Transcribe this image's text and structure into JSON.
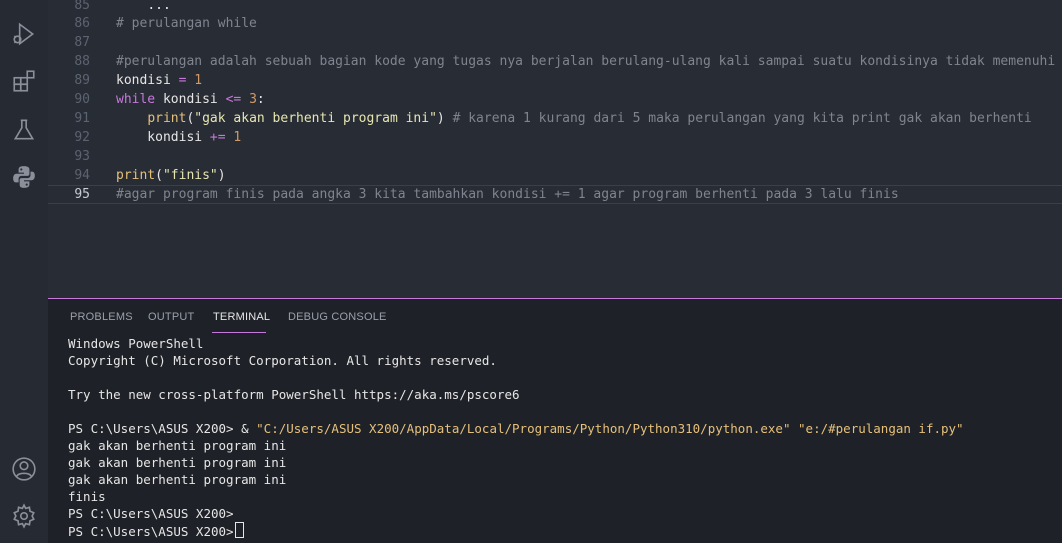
{
  "activity_bar": {
    "icons": [
      "run-debug-icon",
      "extensions-icon",
      "testing-icon",
      "python-icon",
      "account-icon",
      "settings-gear-icon"
    ]
  },
  "editor": {
    "lines": [
      {
        "num": "85",
        "tokens": [
          {
            "t": "    ",
            "c": ""
          },
          {
            "t": "...",
            "c": "c-var"
          }
        ]
      },
      {
        "num": "86",
        "tokens": [
          {
            "t": "# perulangan while",
            "c": "c-comment"
          }
        ]
      },
      {
        "num": "87",
        "tokens": []
      },
      {
        "num": "88",
        "tokens": [
          {
            "t": "#perulangan adalah sebuah bagian kode yang tugas nya berjalan berulang-ulang kali sampai suatu kondisinya tidak memenuhi",
            "c": "c-comment"
          }
        ]
      },
      {
        "num": "89",
        "tokens": [
          {
            "t": "kondisi ",
            "c": "c-var"
          },
          {
            "t": "=",
            "c": "c-op"
          },
          {
            "t": " ",
            "c": ""
          },
          {
            "t": "1",
            "c": "c-num"
          }
        ]
      },
      {
        "num": "90",
        "tokens": [
          {
            "t": "while",
            "c": "c-kw"
          },
          {
            "t": " kondisi ",
            "c": "c-var"
          },
          {
            "t": "<=",
            "c": "c-op"
          },
          {
            "t": " ",
            "c": ""
          },
          {
            "t": "3",
            "c": "c-num"
          },
          {
            "t": ":",
            "c": "c-var"
          }
        ]
      },
      {
        "num": "91",
        "tokens": [
          {
            "t": "    ",
            "c": ""
          },
          {
            "t": "print",
            "c": "c-fn"
          },
          {
            "t": "(",
            "c": "c-var"
          },
          {
            "t": "\"gak akan berhenti program ini\"",
            "c": "c-str"
          },
          {
            "t": ") ",
            "c": "c-var"
          },
          {
            "t": "# karena 1 kurang dari 5 maka perulangan yang kita print gak akan berhenti",
            "c": "c-comment"
          }
        ]
      },
      {
        "num": "92",
        "tokens": [
          {
            "t": "    kondisi ",
            "c": "c-var"
          },
          {
            "t": "+=",
            "c": "c-op"
          },
          {
            "t": " ",
            "c": ""
          },
          {
            "t": "1",
            "c": "c-num"
          }
        ]
      },
      {
        "num": "93",
        "tokens": []
      },
      {
        "num": "94",
        "tokens": [
          {
            "t": "print",
            "c": "c-fn"
          },
          {
            "t": "(",
            "c": "c-var"
          },
          {
            "t": "\"finis\"",
            "c": "c-str"
          },
          {
            "t": ")",
            "c": "c-var"
          }
        ]
      },
      {
        "num": "95",
        "tokens": [
          {
            "t": "#agar program finis pada angka 3 kita tambahkan kondisi += 1 agar program berhenti pada 3 lalu finis",
            "c": "c-comment"
          }
        ]
      }
    ]
  },
  "panel": {
    "tabs": [
      {
        "label": "PROBLEMS",
        "active": false
      },
      {
        "label": "OUTPUT",
        "active": false
      },
      {
        "label": "TERMINAL",
        "active": true
      },
      {
        "label": "DEBUG CONSOLE",
        "active": false
      }
    ],
    "terminal": {
      "header1": "Windows PowerShell",
      "header2": "Copyright (C) Microsoft Corporation. All rights reserved.",
      "tip": "Try the new cross-platform PowerShell https://aka.ms/pscore6",
      "cmd_prompt": "PS C:\\Users\\ASUS X200> & ",
      "cmd_exe": "\"C:/Users/ASUS X200/AppData/Local/Programs/Python/Python310/python.exe\"",
      "cmd_sep": " ",
      "cmd_file": "\"e:/#perulangan if.py\"",
      "output": [
        "gak akan berhenti program ini",
        "gak akan berhenti program ini",
        "gak akan berhenti program ini",
        "finis"
      ],
      "prompt1": "PS C:\\Users\\ASUS X200>",
      "prompt2": "PS C:\\Users\\ASUS X200>"
    }
  }
}
